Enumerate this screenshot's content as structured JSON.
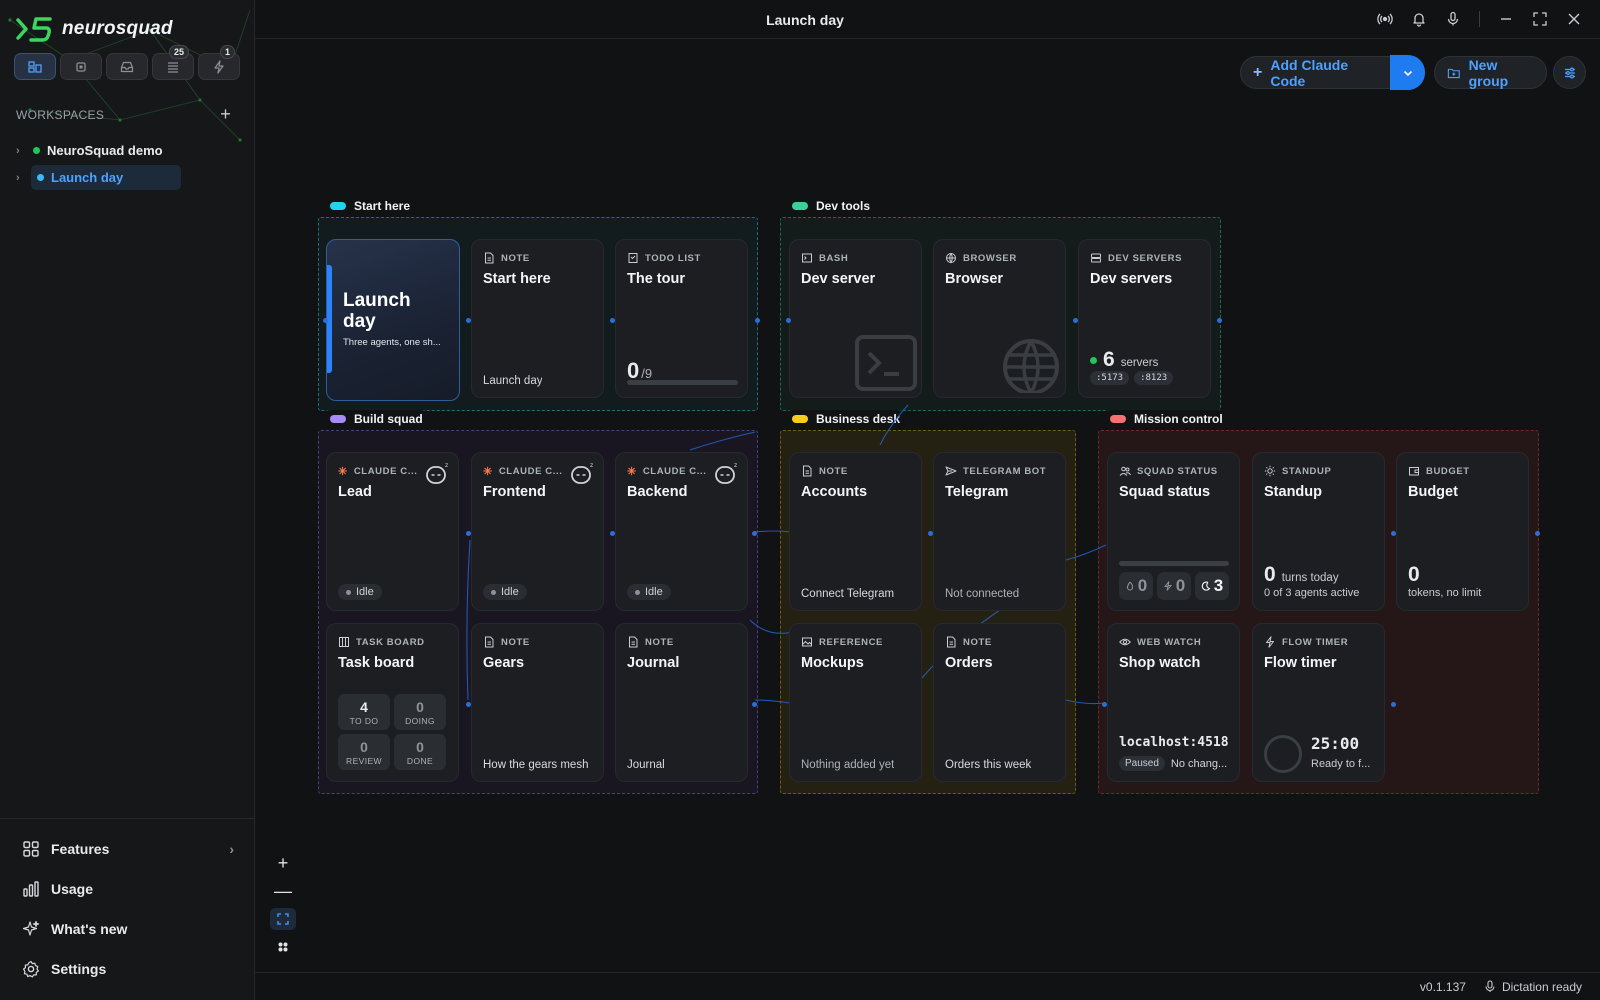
{
  "brand": {
    "name": "neurosquad"
  },
  "sidebar": {
    "tabs": [
      {
        "icon": "canvas-icon",
        "badge": ""
      },
      {
        "icon": "cpu-icon",
        "badge": ""
      },
      {
        "icon": "inbox-icon",
        "badge": ""
      },
      {
        "icon": "list-icon",
        "badge": "25"
      },
      {
        "icon": "bolt-icon",
        "badge": "1"
      }
    ],
    "workspaces_label": "WORKSPACES",
    "add_label": "+",
    "workspaces": [
      {
        "name": "NeuroSquad demo",
        "dot_color": "#22c55e"
      },
      {
        "name": "Launch day",
        "dot_color": "#38bdf8"
      }
    ],
    "nav": {
      "features": "Features",
      "usage": "Usage",
      "whats_new": "What's new",
      "settings": "Settings"
    }
  },
  "topbar": {
    "title": "Launch day"
  },
  "actions": {
    "add_claude": "Add Claude Code",
    "new_group": "New group"
  },
  "groups": {
    "start_here": {
      "label": "Start here",
      "color": "#22d3ee"
    },
    "dev_tools": {
      "label": "Dev tools",
      "color": "#34d399"
    },
    "build_squad": {
      "label": "Build squad",
      "color": "#a78bfa"
    },
    "business_desk": {
      "label": "Business desk",
      "color": "#facc15"
    },
    "mission_control": {
      "label": "Mission control",
      "color": "#f87171"
    }
  },
  "cards": {
    "hero": {
      "title": "Launch day",
      "subtitle": "Three agents, one sh..."
    },
    "start_note": {
      "kind": "NOTE",
      "title": "Start here",
      "foot": "Launch day"
    },
    "todo": {
      "kind": "TODO LIST",
      "title": "The tour",
      "done": "0",
      "total": "/9"
    },
    "bash": {
      "kind": "BASH",
      "title": "Dev server"
    },
    "browser": {
      "kind": "BROWSER",
      "title": "Browser"
    },
    "servers": {
      "kind": "DEV SERVERS",
      "title": "Dev servers",
      "count": "6",
      "unit": "servers",
      "ports": [
        ":5173",
        ":8123"
      ]
    },
    "lead": {
      "kind": "CLAUDE C...",
      "title": "Lead",
      "status": "Idle"
    },
    "frontend": {
      "kind": "CLAUDE C...",
      "title": "Frontend",
      "status": "Idle"
    },
    "backend": {
      "kind": "CLAUDE C...",
      "title": "Backend",
      "status": "Idle"
    },
    "accounts": {
      "kind": "NOTE",
      "title": "Accounts",
      "foot": "Connect Telegram"
    },
    "telegram": {
      "kind": "TELEGRAM BOT",
      "title": "Telegram",
      "foot": "Not connected"
    },
    "squad": {
      "kind": "SQUAD STATUS",
      "title": "Squad status",
      "chips": [
        "0",
        "0",
        "3"
      ]
    },
    "standup": {
      "kind": "STANDUP",
      "title": "Standup",
      "num": "0",
      "unit": "turns today",
      "sub": "0 of 3 agents active"
    },
    "budget": {
      "kind": "BUDGET",
      "title": "Budget",
      "num": "0",
      "sub": "tokens, no limit"
    },
    "taskboard": {
      "kind": "TASK BOARD",
      "title": "Task board",
      "cells": [
        {
          "v": "4",
          "l": "TO DO"
        },
        {
          "v": "0",
          "l": "DOING"
        },
        {
          "v": "0",
          "l": "REVIEW"
        },
        {
          "v": "0",
          "l": "DONE"
        }
      ]
    },
    "gears": {
      "kind": "NOTE",
      "title": "Gears",
      "foot": "How the gears mesh"
    },
    "journal": {
      "kind": "NOTE",
      "title": "Journal",
      "foot": "Journal"
    },
    "mockups": {
      "kind": "REFERENCE",
      "title": "Mockups",
      "foot": "Nothing added yet"
    },
    "orders": {
      "kind": "NOTE",
      "title": "Orders",
      "foot": "Orders this week"
    },
    "webwatch": {
      "kind": "WEB WATCH",
      "title": "Shop watch",
      "host": "localhost:4518",
      "pill": "Paused",
      "status": "No chang..."
    },
    "flowtimer": {
      "kind": "FLOW TIMER",
      "title": "Flow timer",
      "time": "25:00",
      "sub": "Ready to f..."
    }
  },
  "status": {
    "version": "v0.1.137",
    "dictation": "Dictation ready"
  },
  "colors": {
    "accent": "#1e7bf0",
    "link": "#4ea1ff",
    "background": "#111213"
  }
}
